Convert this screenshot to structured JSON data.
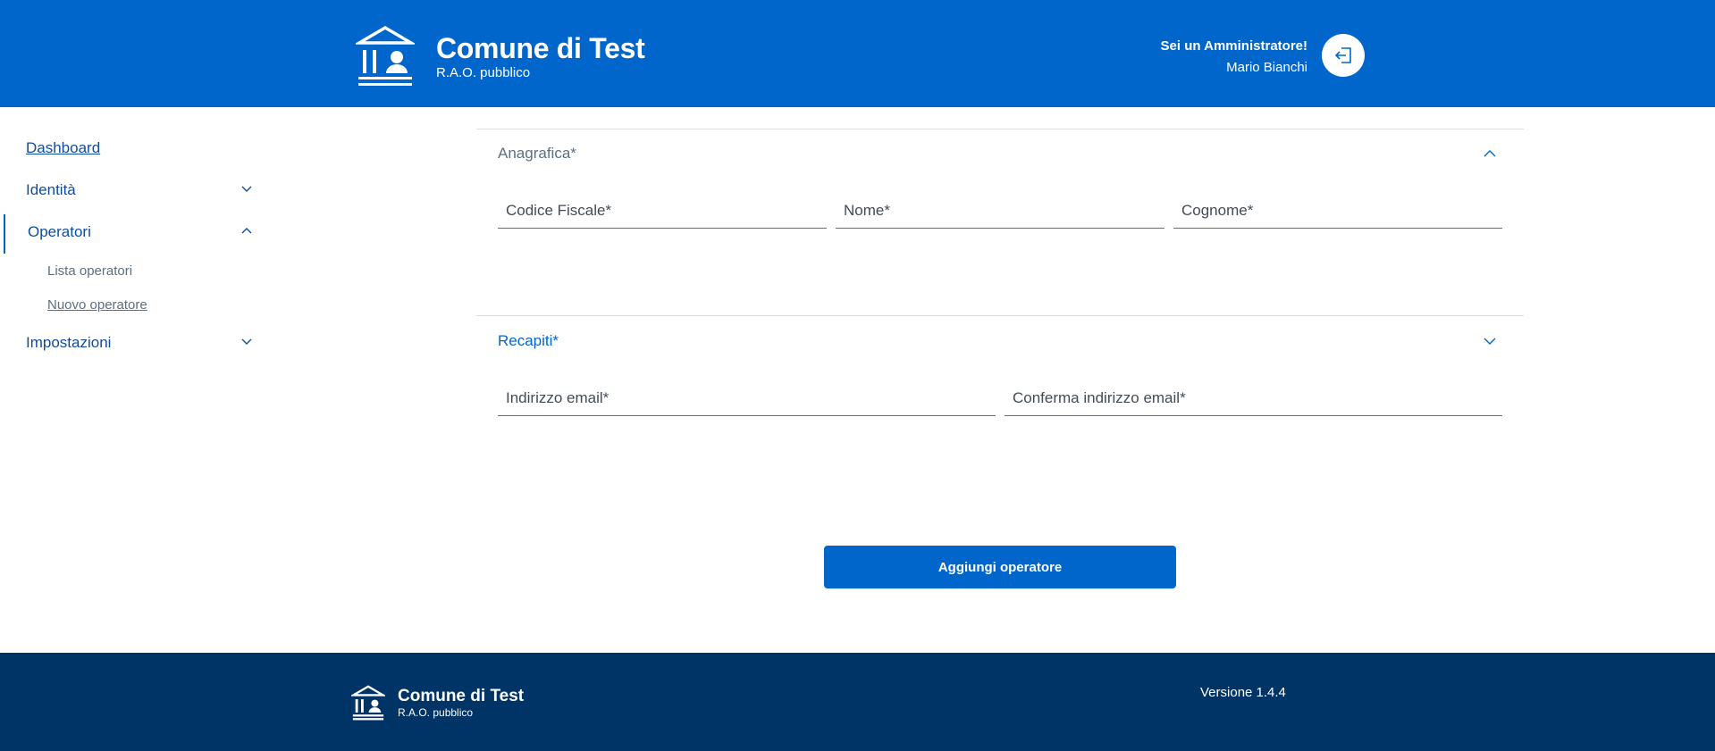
{
  "header": {
    "title": "Comune di Test",
    "subtitle": "R.A.O. pubblico",
    "user_role": "Sei un Amministratore!",
    "user_name": "Mario Bianchi",
    "logo_icon": "town-hall-icon",
    "logout_icon": "logout-icon"
  },
  "sidebar": {
    "items": [
      {
        "label": "Dashboard"
      },
      {
        "label": "Identità",
        "expanded": false
      },
      {
        "label": "Operatori",
        "expanded": true,
        "active": true
      },
      {
        "label": "Impostazioni",
        "expanded": false
      }
    ],
    "operatori_sub": [
      {
        "label": "Lista operatori"
      },
      {
        "label": "Nuovo operatore"
      }
    ]
  },
  "form": {
    "anagrafica": {
      "title": "Anagrafica*",
      "expanded": true,
      "fields": {
        "codice_fiscale": {
          "placeholder": "Codice Fiscale*",
          "value": ""
        },
        "nome": {
          "placeholder": "Nome*",
          "value": ""
        },
        "cognome": {
          "placeholder": "Cognome*",
          "value": ""
        }
      }
    },
    "recapiti": {
      "title": "Recapiti*",
      "expanded": false,
      "fields": {
        "email": {
          "placeholder": "Indirizzo email*",
          "value": ""
        },
        "conferma_email": {
          "placeholder": "Conferma indirizzo email*",
          "value": ""
        }
      }
    },
    "submit_label": "Aggiungi operatore"
  },
  "footer": {
    "title": "Comune di Test",
    "subtitle": "R.A.O. pubblico",
    "version": "Versione 1.4.4"
  },
  "colors": {
    "primary": "#0066cc",
    "footer_bg": "#003366",
    "nav_text": "#0f4c9c",
    "muted_text": "#5c6f82"
  }
}
